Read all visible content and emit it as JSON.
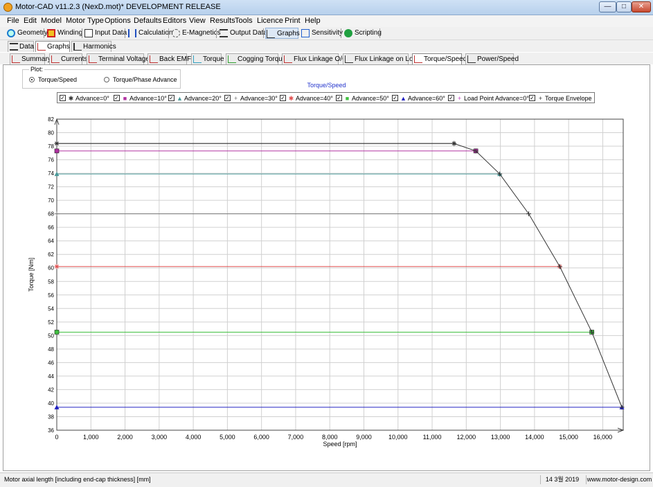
{
  "window": {
    "title": "Motor-CAD v11.2.3 (NexD.mot)* DEVELOPMENT RELEASE",
    "buttons": {
      "minimize": "—",
      "maximize": "□",
      "close": "✕"
    }
  },
  "menu": [
    "File",
    "Edit",
    "Model",
    "Motor Type",
    "Options",
    "Defaults",
    "Editors",
    "View",
    "Results",
    "Tools",
    "Licence",
    "Print",
    "Help"
  ],
  "toolbar": {
    "items": [
      {
        "label": "Geometry",
        "icon": "geometry-icon"
      },
      {
        "label": "Winding",
        "icon": "winding-icon"
      },
      {
        "label": "Input Data",
        "icon": "input-data-icon"
      },
      {
        "label": "Calculation",
        "icon": "calculation-icon"
      },
      {
        "label": "E-Magnetics",
        "icon": "e-magnetics-icon"
      },
      {
        "label": "Output Data",
        "icon": "output-data-icon"
      },
      {
        "label": "Graphs",
        "icon": "graphs-icon",
        "active": true
      },
      {
        "label": "Sensitivity",
        "icon": "sensitivity-icon"
      },
      {
        "label": "Scripting",
        "icon": "scripting-icon"
      }
    ]
  },
  "view_tabs": [
    {
      "label": "Data",
      "icon": "data-grid-icon"
    },
    {
      "label": "Graphs",
      "icon": "graph-line-icon",
      "selected": true
    },
    {
      "label": "Harmonics",
      "icon": "harmonics-bar-icon"
    }
  ],
  "graph_tabs": [
    {
      "label": "Summary"
    },
    {
      "label": "Currents"
    },
    {
      "label": "Terminal Voltages"
    },
    {
      "label": "Back EMF"
    },
    {
      "label": "Torque"
    },
    {
      "label": "Cogging Torque"
    },
    {
      "label": "Flux Linkage O/C"
    },
    {
      "label": "Flux Linkage on Load"
    },
    {
      "label": "Torque/Speed",
      "selected": true
    },
    {
      "label": "Power/Speed"
    }
  ],
  "plot_options": {
    "group_label": "Plot:",
    "options": [
      {
        "label": "Torque/Speed",
        "selected": true
      },
      {
        "label": "Torque/Phase Advance",
        "selected": false
      }
    ]
  },
  "chart_data": {
    "type": "line",
    "title": "Torque/Speed",
    "xlabel": "Speed [rpm]",
    "ylabel": "Torque [Nm]",
    "xlim": [
      0,
      16600
    ],
    "ylim": [
      36,
      82
    ],
    "xticks": [
      0,
      1000,
      2000,
      3000,
      4000,
      5000,
      6000,
      7000,
      8000,
      9000,
      10000,
      11000,
      12000,
      13000,
      14000,
      15000,
      16000
    ],
    "xtick_labels": [
      "0",
      "1,000",
      "2,000",
      "3,000",
      "4,000",
      "5,000",
      "6,000",
      "7,000",
      "8,000",
      "9,000",
      "10,000",
      "11,000",
      "12,000",
      "13,000",
      "14,000",
      "15,000",
      "16,000"
    ],
    "yticks": [
      36,
      38,
      40,
      42,
      44,
      46,
      48,
      50,
      52,
      54,
      56,
      58,
      60,
      62,
      64,
      66,
      68,
      70,
      72,
      74,
      76,
      78,
      80,
      82
    ],
    "grid": true,
    "legend_placement": "top",
    "series": [
      {
        "name": "Advance=0°",
        "color": "#333333",
        "marker": "✱",
        "points": [
          [
            0,
            78.4
          ],
          [
            11640,
            78.4
          ]
        ]
      },
      {
        "name": "Advance=10°",
        "color": "#b030a0",
        "marker": "■",
        "points": [
          [
            0,
            77.3
          ],
          [
            12280,
            77.3
          ]
        ]
      },
      {
        "name": "Advance=20°",
        "color": "#4a9a9a",
        "marker": "▲",
        "points": [
          [
            0,
            73.9
          ],
          [
            12980,
            73.9
          ]
        ]
      },
      {
        "name": "Advance=30°",
        "color": "#777777",
        "marker": "+",
        "points": [
          [
            0,
            68.0
          ],
          [
            13830,
            68.0
          ]
        ]
      },
      {
        "name": "Advance=40°",
        "color": "#e05050",
        "marker": "✱",
        "points": [
          [
            0,
            60.2
          ],
          [
            14740,
            60.2
          ]
        ]
      },
      {
        "name": "Advance=50°",
        "color": "#40c040",
        "marker": "■",
        "points": [
          [
            0,
            50.5
          ],
          [
            15680,
            50.5
          ]
        ]
      },
      {
        "name": "Advance=60°",
        "color": "#2020c0",
        "marker": "▲",
        "points": [
          [
            0,
            39.4
          ],
          [
            16560,
            39.4
          ]
        ]
      },
      {
        "name": "Load Point Advance=0°",
        "color": "#c040c0",
        "marker": "+",
        "points": []
      },
      {
        "name": "Torque Envelope",
        "color": "#333333",
        "marker": "+",
        "points": [
          [
            0,
            78.4
          ],
          [
            11640,
            78.4
          ],
          [
            12280,
            77.3
          ],
          [
            12980,
            73.9
          ],
          [
            13830,
            68.0
          ],
          [
            14740,
            60.2
          ],
          [
            15680,
            50.5
          ],
          [
            16560,
            39.4
          ]
        ]
      }
    ]
  },
  "status": {
    "left": "Motor axial length [including end-cap thickness] [mm]",
    "date": "14 3월 2019",
    "url": "www.motor-design.com"
  }
}
